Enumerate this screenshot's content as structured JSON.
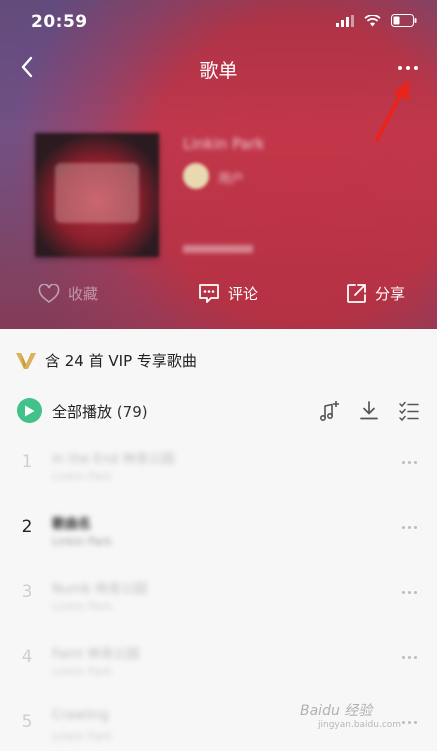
{
  "status": {
    "time": "20:59"
  },
  "nav": {
    "title": "歌单"
  },
  "playlist": {
    "title": "Linkin Park",
    "author": "用户"
  },
  "actions": {
    "collect": "收藏",
    "comment": "评论",
    "share": "分享"
  },
  "vip": {
    "text": "含 24 首 VIP 专享歌曲"
  },
  "play_all": {
    "label": "全部播放",
    "count": "(79)"
  },
  "songs": [
    {
      "index": "1",
      "name": "In the End 林肯公园",
      "sub": "Linkin Park"
    },
    {
      "index": "2",
      "name": "歌曲名",
      "sub": "Linkin Park"
    },
    {
      "index": "3",
      "name": "Numb 林肯公园",
      "sub": "Linkin Park"
    },
    {
      "index": "4",
      "name": "Faint 林肯公园",
      "sub": "Linkin Park"
    },
    {
      "index": "5",
      "name": "Crawling",
      "sub": "Linkin Park"
    }
  ],
  "watermark": {
    "brand": "Baidu 经验",
    "url": "jingyan.baidu.com"
  },
  "colors": {
    "accent_green": "#41c28a",
    "vip_gold": "#d9b25a",
    "annotation_red": "#e8241d"
  }
}
